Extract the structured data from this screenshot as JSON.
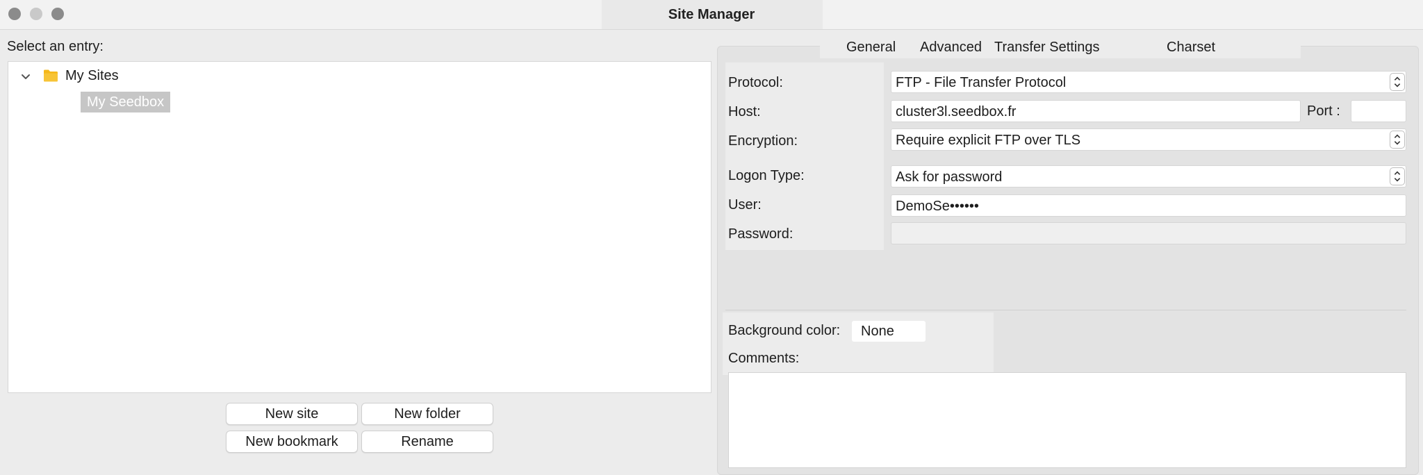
{
  "window": {
    "title": "Site Manager"
  },
  "left": {
    "select_label": "Select an entry:",
    "tree": {
      "root": "My Sites",
      "selected": "My Seedbox"
    },
    "buttons": {
      "new_site": "New site",
      "new_folder": "New folder",
      "new_bookmark": "New bookmark",
      "rename": "Rename"
    }
  },
  "tabs": {
    "general": "General",
    "advanced": "Advanced",
    "transfer": "Transfer Settings",
    "charset": "Charset"
  },
  "form": {
    "protocol_label": "Protocol:",
    "protocol_value": "FTP - File Transfer Protocol",
    "host_label": "Host:",
    "host_value": "cluster3l.seedbox.fr",
    "port_label": "Port :",
    "port_value": "",
    "encryption_label": "Encryption:",
    "encryption_value": "Require explicit FTP over TLS",
    "logon_label": "Logon Type:",
    "logon_value": "Ask for password",
    "user_label": "User:",
    "user_value": "DemoSe••••••",
    "password_label": "Password:",
    "password_value": "",
    "bgcolor_label": "Background color:",
    "bgcolor_value": "None",
    "comments_label": "Comments:",
    "comments_value": ""
  },
  "colors": {
    "folder": "#f5b81a",
    "selection": "#c6c6c6"
  },
  "icons": {
    "chevron": "chevron-down-icon",
    "folder": "folder-icon",
    "stepper": "stepper-icon"
  }
}
